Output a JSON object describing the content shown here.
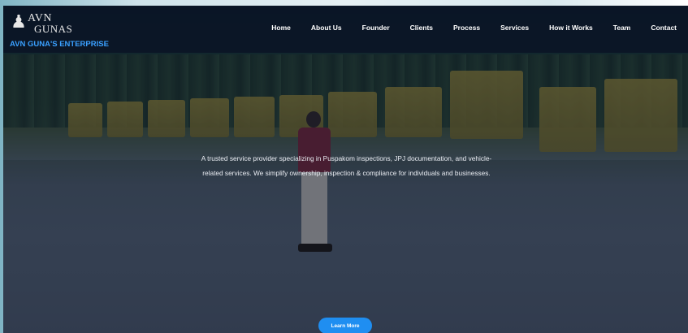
{
  "brand": {
    "logo_line1": "AVN",
    "logo_line2": "GUNAS",
    "name": "AVN GUNA'S ENTERPRISE"
  },
  "nav": {
    "items": [
      {
        "label": "Home"
      },
      {
        "label": "About Us"
      },
      {
        "label": "Founder"
      },
      {
        "label": "Clients"
      },
      {
        "label": "Process"
      },
      {
        "label": "Services"
      },
      {
        "label": "How it Works"
      },
      {
        "label": "Team"
      },
      {
        "label": "Contact"
      }
    ]
  },
  "hero": {
    "tagline": "A trusted service provider specializing in Puspakom inspections, JPJ documentation, and vehicle-related services. We simplify ownership, inspection & compliance for individuals and businesses.",
    "cta_label": "Learn More"
  },
  "colors": {
    "nav_bg": "#0b1626",
    "brand_accent": "#3aa0ff",
    "cta_bg": "#1f8ef1"
  }
}
